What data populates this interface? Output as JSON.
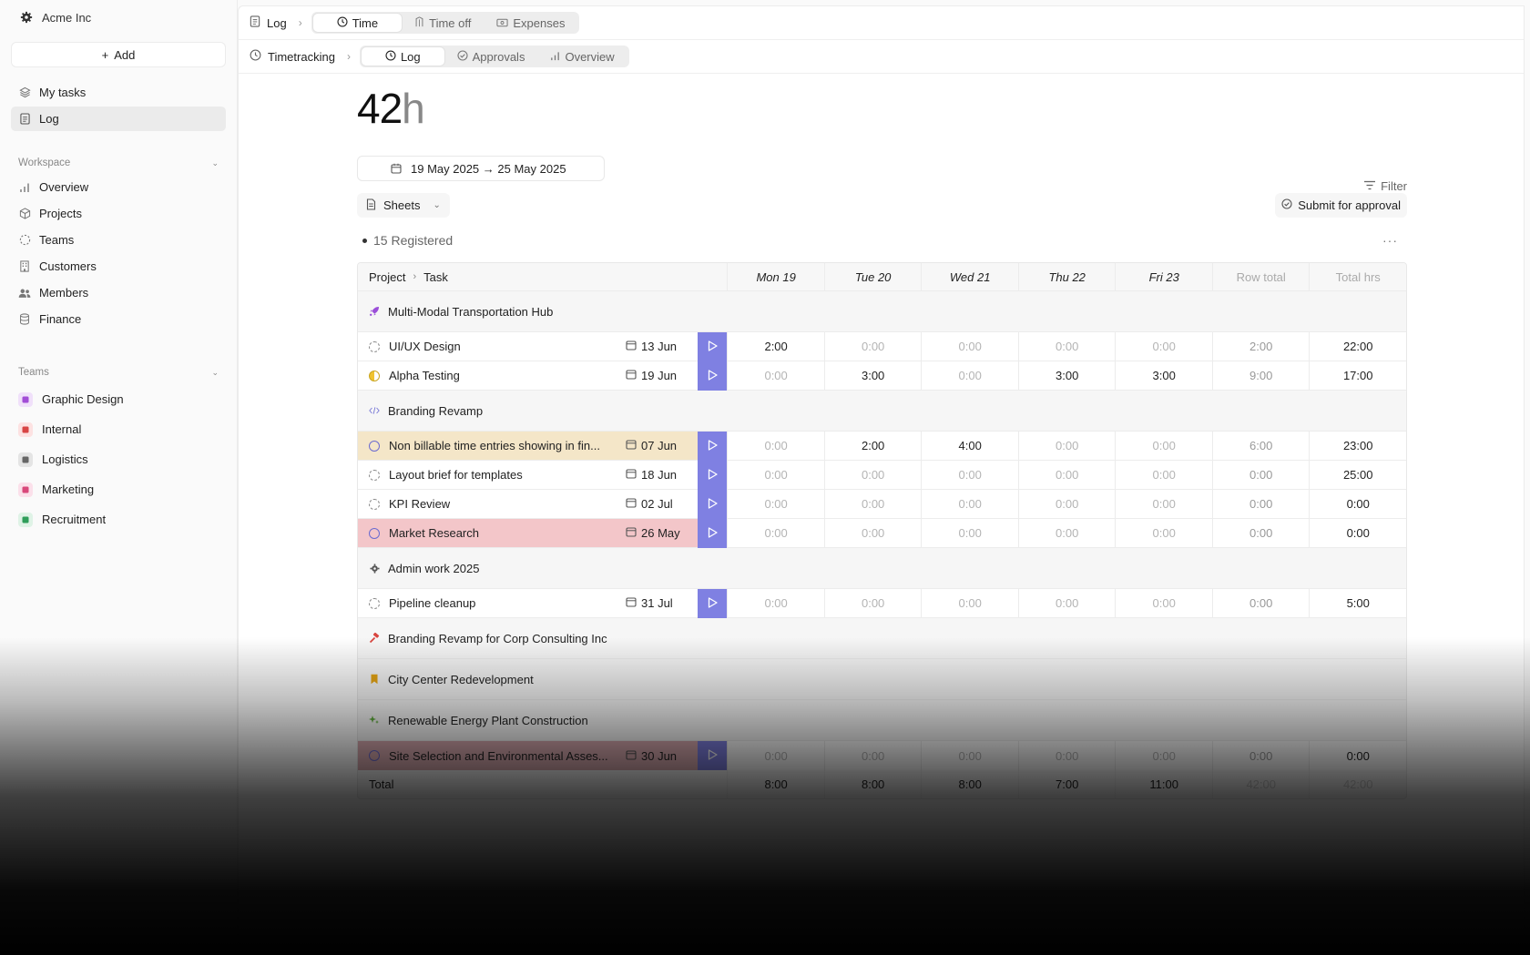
{
  "org": {
    "name": "Acme Inc"
  },
  "sidebar": {
    "add_label": "Add",
    "top_items": [
      {
        "label": "My tasks",
        "icon": "layers-icon"
      },
      {
        "label": "Log",
        "icon": "document-icon",
        "active": true
      }
    ],
    "workspace": {
      "title": "Workspace",
      "items": [
        {
          "label": "Overview",
          "icon": "bar-chart-icon"
        },
        {
          "label": "Projects",
          "icon": "cube-icon"
        },
        {
          "label": "Teams",
          "icon": "dashed-circle-icon"
        },
        {
          "label": "Customers",
          "icon": "building-icon"
        },
        {
          "label": "Members",
          "icon": "people-icon"
        },
        {
          "label": "Finance",
          "icon": "database-icon"
        }
      ]
    },
    "teams": {
      "title": "Teams",
      "items": [
        {
          "label": "Graphic Design",
          "color": "#f0e0fa",
          "fg": "#a24dd6"
        },
        {
          "label": "Internal",
          "color": "#fde2e2",
          "fg": "#d84545"
        },
        {
          "label": "Logistics",
          "color": "#e4e4e4",
          "fg": "#666666"
        },
        {
          "label": "Marketing",
          "color": "#fbe0ea",
          "fg": "#d9487a"
        },
        {
          "label": "Recruitment",
          "color": "#dff3e6",
          "fg": "#2f9e5a"
        }
      ]
    }
  },
  "topbar": {
    "crumb": "Log",
    "tabs": [
      "Time",
      "Time off",
      "Expenses"
    ],
    "selected": 0
  },
  "subbar": {
    "crumb": "Timetracking",
    "tabs": [
      "Log",
      "Approvals",
      "Overview"
    ],
    "selected": 0
  },
  "summary": {
    "total_num": "42",
    "total_unit": "h",
    "date_range": "19 May 2025 → 25 May 2025",
    "filter": "Filter",
    "sheets": "Sheets",
    "submit": "Submit for approval",
    "registered": "15 Registered"
  },
  "table": {
    "header": {
      "project": "Project",
      "task": "Task",
      "days": [
        "Mon 19",
        "Tue 20",
        "Wed 21",
        "Thu 22",
        "Fri 23"
      ],
      "row_total": "Row total",
      "total_hrs": "Total hrs"
    },
    "rows": [
      {
        "kind": "group",
        "label": "Multi-Modal Transportation Hub",
        "icon": "rocket-icon",
        "color": "#9b4fd9"
      },
      {
        "kind": "task",
        "name": "UI/UX Design",
        "date": "13 Jun",
        "status": "dashed",
        "hours": [
          "2:00",
          "0:00",
          "0:00",
          "0:00",
          "0:00"
        ],
        "row_total": "2:00",
        "total": "22:00"
      },
      {
        "kind": "task",
        "name": "Alpha Testing",
        "date": "19 Jun",
        "status": "half",
        "hours": [
          "0:00",
          "3:00",
          "0:00",
          "3:00",
          "3:00"
        ],
        "row_total": "9:00",
        "total": "17:00"
      },
      {
        "kind": "group",
        "label": "Branding Revamp",
        "icon": "code-icon",
        "color": "#7a7ad6"
      },
      {
        "kind": "task",
        "name": "Non billable time entries showing in fin...",
        "date": "07 Jun",
        "status": "solid",
        "hl": "hl-yellow",
        "hours": [
          "0:00",
          "2:00",
          "4:00",
          "0:00",
          "0:00"
        ],
        "row_total": "6:00",
        "total": "23:00"
      },
      {
        "kind": "task",
        "name": "Layout brief for templates",
        "date": "18 Jun",
        "status": "dashed",
        "hours": [
          "0:00",
          "0:00",
          "0:00",
          "0:00",
          "0:00"
        ],
        "row_total": "0:00",
        "total": "25:00"
      },
      {
        "kind": "task",
        "name": "KPI Review",
        "date": "02 Jul",
        "status": "dashed",
        "hours": [
          "0:00",
          "0:00",
          "0:00",
          "0:00",
          "0:00"
        ],
        "row_total": "0:00",
        "total": "0:00"
      },
      {
        "kind": "task",
        "name": "Market Research",
        "date": "26 May",
        "status": "solid",
        "hl": "hl-red",
        "hours": [
          "0:00",
          "0:00",
          "0:00",
          "0:00",
          "0:00"
        ],
        "row_total": "0:00",
        "total": "0:00"
      },
      {
        "kind": "group",
        "label": "Admin work 2025",
        "icon": "gear-icon",
        "color": "#555555"
      },
      {
        "kind": "task",
        "name": "Pipeline cleanup",
        "date": "31 Jul",
        "status": "dashed",
        "hours": [
          "0:00",
          "0:00",
          "0:00",
          "0:00",
          "0:00"
        ],
        "row_total": "0:00",
        "total": "5:00"
      },
      {
        "kind": "group",
        "label": "Branding Revamp for Corp Consulting Inc",
        "icon": "hammer-icon",
        "color": "#d9453f"
      },
      {
        "kind": "group",
        "label": "City Center Redevelopment",
        "icon": "bookmark-icon",
        "color": "#e6a514"
      },
      {
        "kind": "group",
        "label": "Renewable Energy Plant Construction",
        "icon": "sparkle-icon",
        "color": "#5fae3b"
      },
      {
        "kind": "task",
        "name": "Site Selection and Environmental Asses...",
        "date": "30 Jun",
        "status": "solid",
        "hl": "hl-red2",
        "hours": [
          "0:00",
          "0:00",
          "0:00",
          "0:00",
          "0:00"
        ],
        "row_total": "0:00",
        "total": "0:00"
      }
    ],
    "footer": {
      "label": "Total",
      "days": [
        "8:00",
        "8:00",
        "8:00",
        "7:00",
        "11:00"
      ],
      "row_total": "42:00",
      "total_hrs": "42:00"
    }
  }
}
